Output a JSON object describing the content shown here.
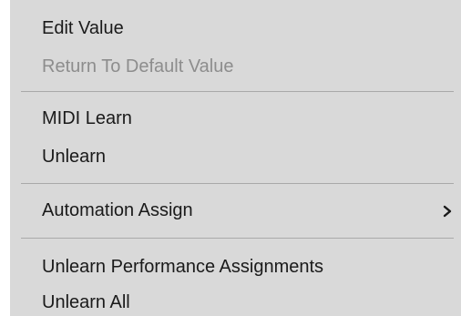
{
  "context_menu": {
    "items": [
      {
        "label": "Edit Value",
        "enabled": true
      },
      {
        "label": "Return To Default Value",
        "enabled": false
      },
      {
        "label": "MIDI Learn",
        "enabled": true
      },
      {
        "label": "Unlearn",
        "enabled": true
      },
      {
        "label": "Automation Assign",
        "enabled": true,
        "submenu": true,
        "icon": "chevron-right-icon"
      },
      {
        "label": "Unlearn Performance Assignments",
        "enabled": true
      },
      {
        "label": "Unlearn All",
        "enabled": true
      }
    ]
  },
  "colors": {
    "menu_background": "#d9d9d9",
    "text": "#1a1a1a",
    "disabled_text": "#8d8d8d",
    "separator": "#a9a9a9"
  }
}
